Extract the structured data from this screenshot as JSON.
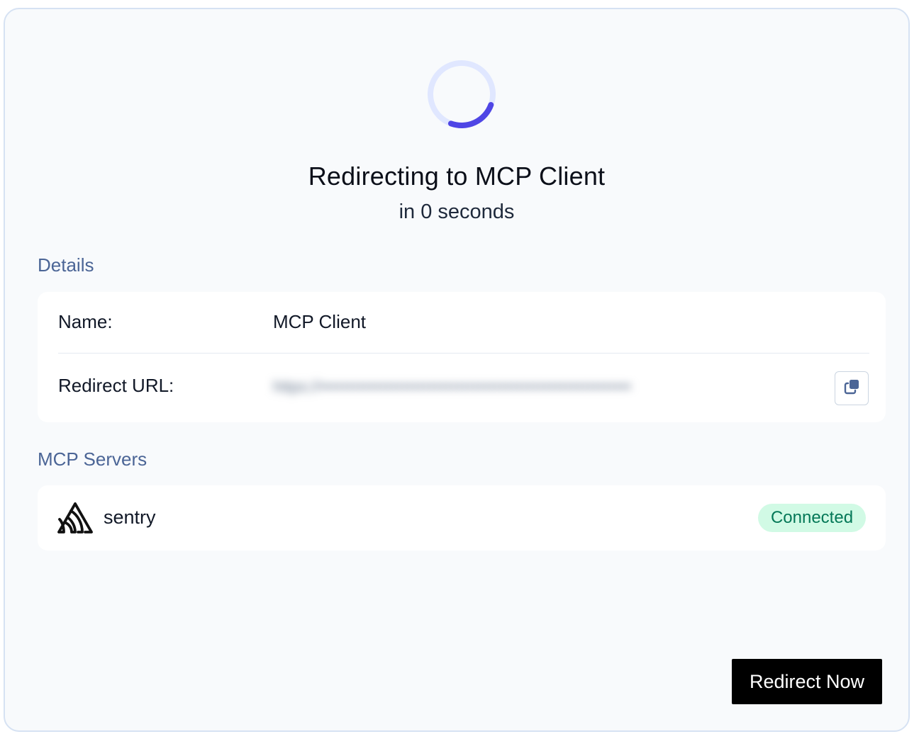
{
  "status": {
    "title": "Redirecting to MCP Client",
    "countdown": "in 0 seconds",
    "spinner_icon": "loading-spinner-icon"
  },
  "details": {
    "section_label": "Details",
    "name_label": "Name:",
    "name_value": "MCP Client",
    "redirect_url_label": "Redirect URL:",
    "redirect_url_value": "https://•••••••••••••••••••••••••••••••••••••••••••••••••••••••••",
    "copy_icon": "copy-icon"
  },
  "servers": {
    "section_label": "MCP Servers",
    "items": [
      {
        "name": "sentry",
        "icon": "sentry-logo-icon",
        "status": "Connected"
      }
    ]
  },
  "actions": {
    "redirect_now_label": "Redirect Now"
  },
  "colors": {
    "accent": "#4f46e5",
    "section_label": "#4b6596",
    "badge_bg": "#d1fae5",
    "badge_text": "#047857",
    "button_bg": "#000000"
  }
}
